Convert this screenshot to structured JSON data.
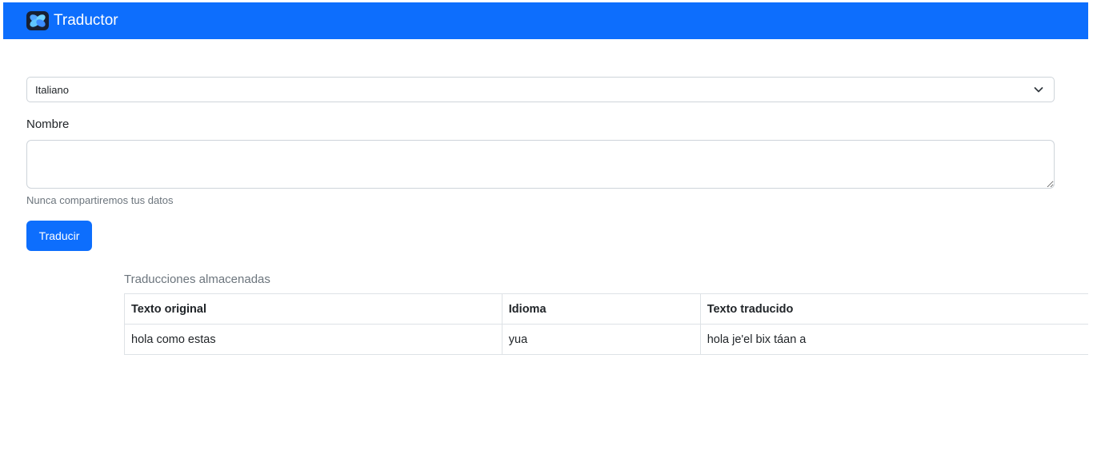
{
  "navbar": {
    "brand": "Traductor",
    "brand_color": "#0d6efd"
  },
  "form": {
    "language_select": {
      "selected": "Italiano",
      "icon": "chevron-down-icon"
    },
    "name_label": "Nombre",
    "name_value": "",
    "help_text": "Nunca compartiremos tus datos",
    "submit_label": "Traducir"
  },
  "table": {
    "caption": "Traducciones almacenadas",
    "headers": [
      "Texto original",
      "Idioma",
      "Texto traducido"
    ],
    "rows": [
      [
        "hola como estas",
        "yua",
        "hola je'el bix táan a"
      ]
    ]
  }
}
